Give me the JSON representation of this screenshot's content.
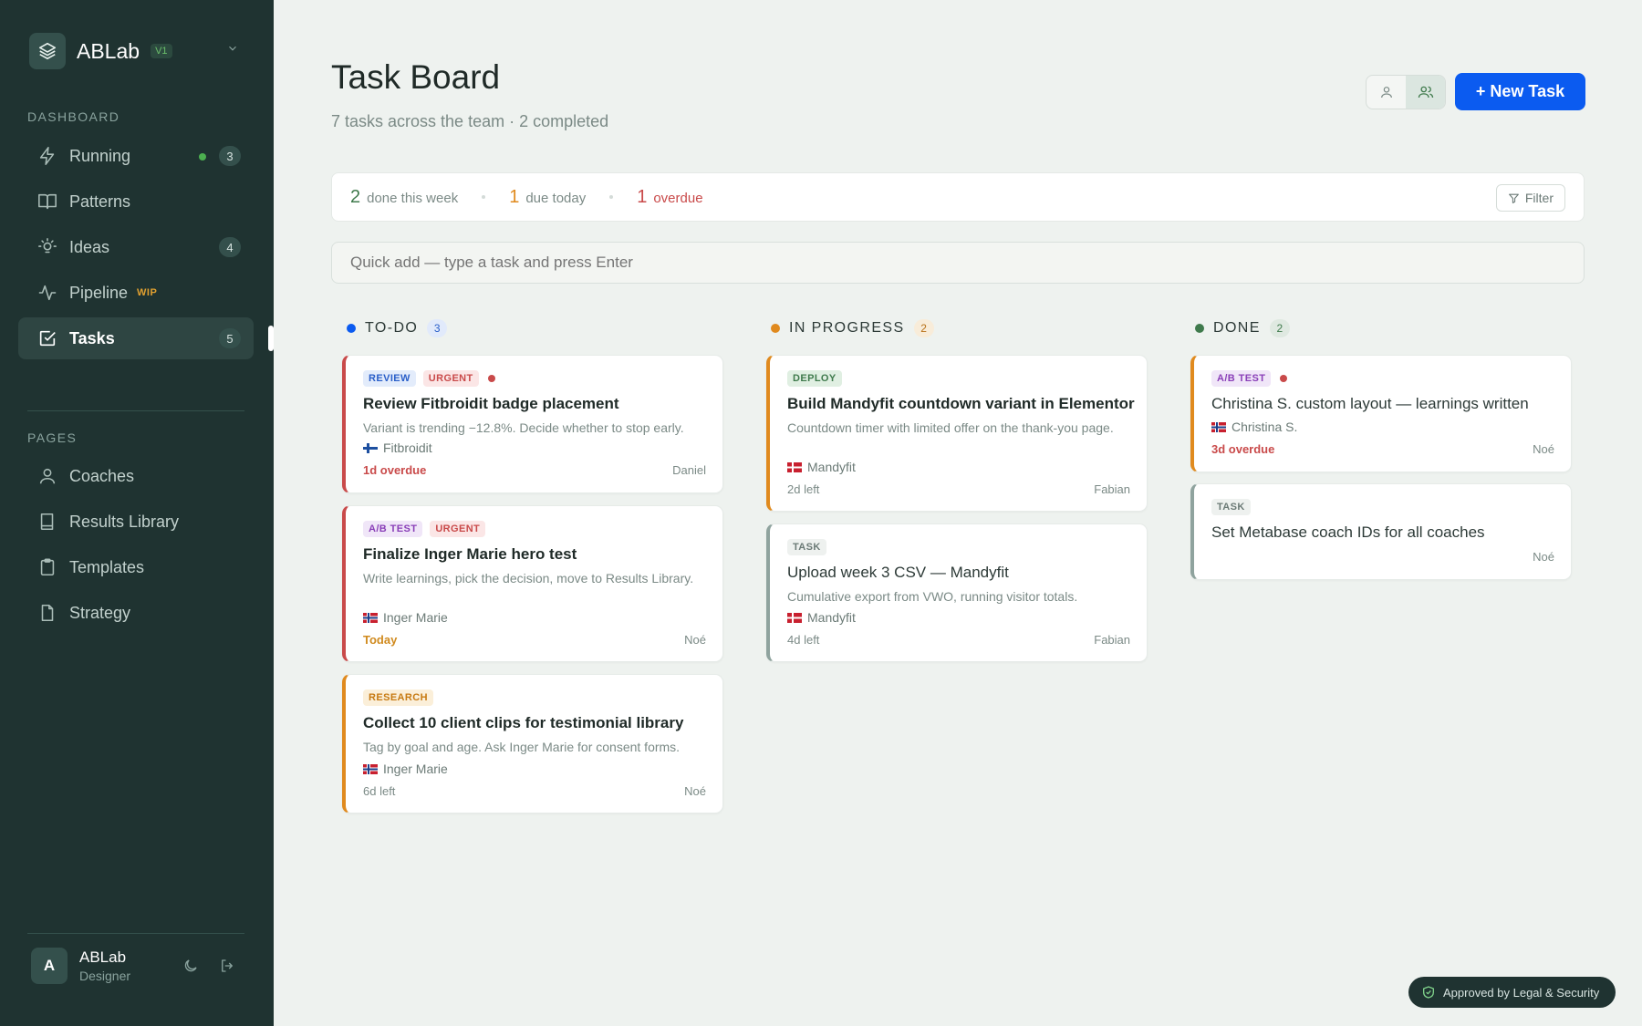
{
  "brand": {
    "name": "ABLab",
    "version": "V1"
  },
  "sidebar": {
    "dashboard_title": "DASHBOARD",
    "pages_title": "PAGES",
    "dashboard_items": [
      {
        "label": "Running",
        "count": "3"
      },
      {
        "label": "Patterns"
      },
      {
        "label": "Ideas",
        "count": "4"
      },
      {
        "label": "Pipeline",
        "badge": "WIP"
      },
      {
        "label": "Tasks",
        "count": "5"
      }
    ],
    "page_items": [
      {
        "label": "Coaches"
      },
      {
        "label": "Results Library"
      },
      {
        "label": "Templates"
      },
      {
        "label": "Strategy"
      }
    ],
    "user": {
      "initial": "A",
      "name": "ABLab",
      "role": "Designer"
    }
  },
  "header": {
    "title": "Task Board",
    "subtitle": "7 tasks across the team · 2 completed",
    "new_task_label": "+ New Task"
  },
  "stats": {
    "done_num": "2",
    "done_label": "done this week",
    "due_num": "1",
    "due_label": "due today",
    "overdue_num": "1",
    "overdue_label": "overdue",
    "filter_label": "Filter"
  },
  "quick_add": {
    "placeholder": "Quick add — type a task and press Enter"
  },
  "columns": [
    {
      "title": "TO-DO",
      "count": "3",
      "cards": [
        {
          "tags": [
            "REVIEW",
            "URGENT"
          ],
          "title": "Review Fitbroidit badge placement",
          "desc": "Variant is trending −12.8%. Decide whether to stop early.",
          "client": "Fitbroidit",
          "due": "1d overdue",
          "owner": "Daniel"
        },
        {
          "tags": [
            "A/B TEST",
            "URGENT"
          ],
          "title": "Finalize Inger Marie hero test",
          "desc": "Write learnings, pick the decision, move to Results Library.",
          "client": "Inger Marie",
          "due": "Today",
          "owner": "Noé"
        },
        {
          "tags": [
            "RESEARCH"
          ],
          "title": "Collect 10 client clips for testimonial library",
          "desc": "Tag by goal and age. Ask Inger Marie for consent forms.",
          "client": "Inger Marie",
          "due": "6d left",
          "owner": "Noé"
        }
      ]
    },
    {
      "title": "IN PROGRESS",
      "count": "2",
      "cards": [
        {
          "tags": [
            "DEPLOY"
          ],
          "title": "Build Mandyfit countdown variant in Elementor",
          "desc": "Countdown timer with limited offer on the thank-you page.",
          "client": "Mandyfit",
          "due": "2d left",
          "owner": "Fabian"
        },
        {
          "tags": [
            "TASK"
          ],
          "title": "Upload week 3 CSV — Mandyfit",
          "desc": "Cumulative export from VWO, running visitor totals.",
          "client": "Mandyfit",
          "due": "4d left",
          "owner": "Fabian"
        }
      ]
    },
    {
      "title": "DONE",
      "count": "2",
      "cards": [
        {
          "tags": [
            "A/B TEST"
          ],
          "title": "Christina S. custom layout — learnings written",
          "client": "Christina S.",
          "due": "3d overdue",
          "owner": "Noé"
        },
        {
          "tags": [
            "TASK"
          ],
          "title": "Set Metabase coach IDs for all coaches",
          "owner": "Noé"
        }
      ]
    }
  ],
  "footer": {
    "approved_label": "Approved by Legal & Security"
  },
  "colors": {
    "accent": "#0b5bf0",
    "sidebar": "#1f3331",
    "urgent": "#c94a4a",
    "warning": "#e08a1e",
    "done": "#3f7a4c"
  }
}
